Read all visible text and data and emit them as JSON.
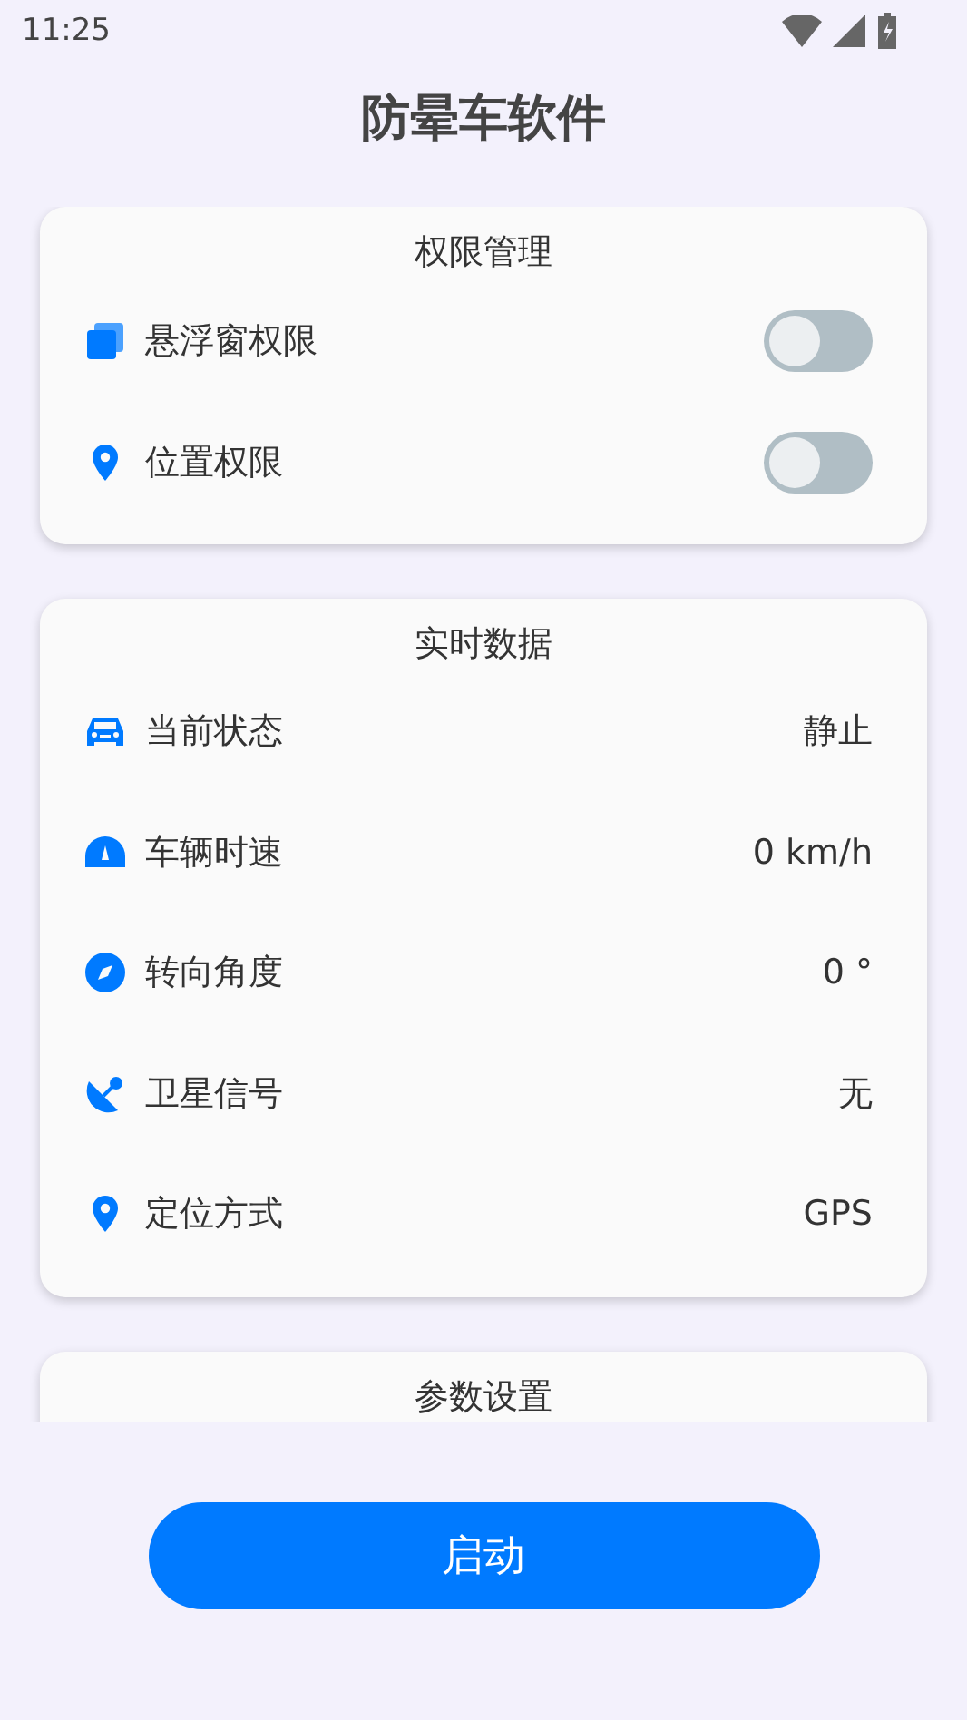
{
  "status_bar": {
    "time": "11:25"
  },
  "title": "防晕车软件",
  "permissions": {
    "title": "权限管理",
    "items": [
      {
        "label": "悬浮窗权限",
        "on": false
      },
      {
        "label": "位置权限",
        "on": false
      }
    ]
  },
  "realtime": {
    "title": "实时数据",
    "items": [
      {
        "label": "当前状态",
        "value": "静止"
      },
      {
        "label": "车辆时速",
        "value": "0 km/h"
      },
      {
        "label": "转向角度",
        "value": "0 °"
      },
      {
        "label": "卫星信号",
        "value": "无"
      },
      {
        "label": "定位方式",
        "value": "GPS"
      }
    ]
  },
  "settings": {
    "title": "参数设置"
  },
  "start_button": "启动"
}
